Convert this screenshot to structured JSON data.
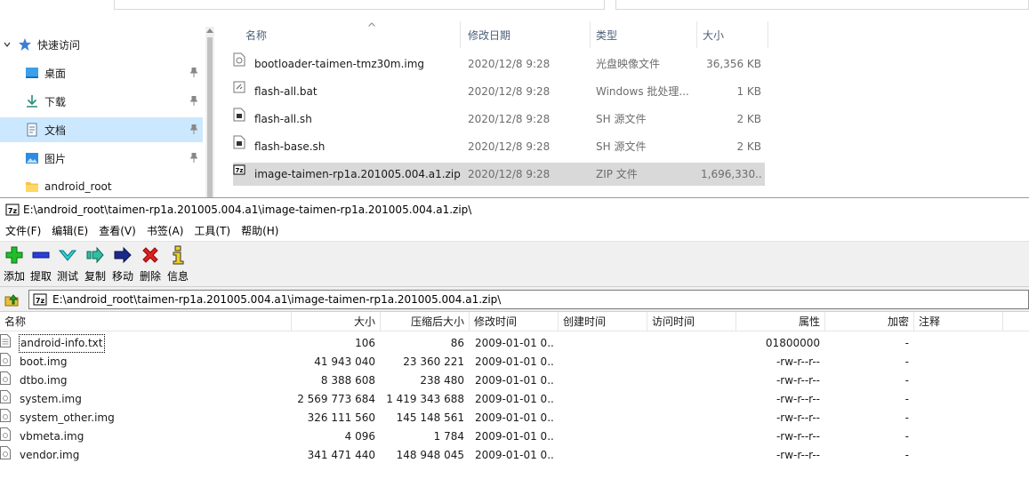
{
  "explorer": {
    "nav_items": [
      {
        "label": "快速访问",
        "icon": "star-icon",
        "pinned": false,
        "selected": false
      },
      {
        "label": "桌面",
        "icon": "desktop-icon",
        "pinned": true,
        "selected": false
      },
      {
        "label": "下载",
        "icon": "download-icon",
        "pinned": true,
        "selected": false
      },
      {
        "label": "文档",
        "icon": "documents-icon",
        "pinned": true,
        "selected": true
      },
      {
        "label": "图片",
        "icon": "pictures-icon",
        "pinned": true,
        "selected": false
      },
      {
        "label": "android_root",
        "icon": "folder-icon",
        "pinned": false,
        "selected": false
      }
    ],
    "columns": {
      "name": "名称",
      "date": "修改日期",
      "type": "类型",
      "size": "大小"
    },
    "files": [
      {
        "name": "bootloader-taimen-tmz30m.img",
        "date": "2020/12/8 9:28",
        "type": "光盘映像文件",
        "size": "36,356 KB",
        "icon": "disc-image-file-icon"
      },
      {
        "name": "flash-all.bat",
        "date": "2020/12/8 9:28",
        "type": "Windows 批处理...",
        "size": "1 KB",
        "icon": "batch-file-icon"
      },
      {
        "name": "flash-all.sh",
        "date": "2020/12/8 9:28",
        "type": "SH 源文件",
        "size": "2 KB",
        "icon": "script-file-icon"
      },
      {
        "name": "flash-base.sh",
        "date": "2020/12/8 9:28",
        "type": "SH 源文件",
        "size": "2 KB",
        "icon": "script-file-icon"
      },
      {
        "name": "image-taimen-rp1a.201005.004.a1.zip",
        "date": "2020/12/8 9:28",
        "type": "ZIP 文件",
        "size": "1,696,330...",
        "icon": "7zip-archive-icon",
        "selected": true
      }
    ]
  },
  "sevenzip": {
    "title": "E:\\android_root\\taimen-rp1a.201005.004.a1\\image-taimen-rp1a.201005.004.a1.zip\\",
    "menu": [
      "文件(F)",
      "编辑(E)",
      "查看(V)",
      "书签(A)",
      "工具(T)",
      "帮助(H)"
    ],
    "toolbar": {
      "add": "添加",
      "extract": "提取",
      "test": "测试",
      "copy": "复制",
      "move": "移动",
      "delete": "删除",
      "info": "信息"
    },
    "address": "E:\\android_root\\taimen-rp1a.201005.004.a1\\image-taimen-rp1a.201005.004.a1.zip\\",
    "columns": {
      "name": "名称",
      "size": "大小",
      "packed": "压缩后大小",
      "modified": "修改时间",
      "created": "创建时间",
      "accessed": "访问时间",
      "attributes": "属性",
      "encrypted": "加密",
      "comment": "注释"
    },
    "rows": [
      {
        "name": "android-info.txt",
        "size": "106",
        "packed": "86",
        "modified": "2009-01-01 0...",
        "attributes": "01800000",
        "encrypted": "-",
        "icon": "text-file-icon"
      },
      {
        "name": "boot.img",
        "size": "41 943 040",
        "packed": "23 360 221",
        "modified": "2009-01-01 0...",
        "attributes": "-rw-r--r--",
        "encrypted": "-",
        "icon": "image-file-icon"
      },
      {
        "name": "dtbo.img",
        "size": "8 388 608",
        "packed": "238 480",
        "modified": "2009-01-01 0...",
        "attributes": "-rw-r--r--",
        "encrypted": "-",
        "icon": "image-file-icon"
      },
      {
        "name": "system.img",
        "size": "2 569 773 684",
        "packed": "1 419 343 688",
        "modified": "2009-01-01 0...",
        "attributes": "-rw-r--r--",
        "encrypted": "-",
        "icon": "image-file-icon"
      },
      {
        "name": "system_other.img",
        "size": "326 111 560",
        "packed": "145 148 561",
        "modified": "2009-01-01 0...",
        "attributes": "-rw-r--r--",
        "encrypted": "-",
        "icon": "image-file-icon"
      },
      {
        "name": "vbmeta.img",
        "size": "4 096",
        "packed": "1 784",
        "modified": "2009-01-01 0...",
        "attributes": "-rw-r--r--",
        "encrypted": "-",
        "icon": "image-file-icon"
      },
      {
        "name": "vendor.img",
        "size": "341 471 440",
        "packed": "148 948 045",
        "modified": "2009-01-01 0...",
        "attributes": "-rw-r--r--",
        "encrypted": "-",
        "icon": "image-file-icon"
      }
    ]
  }
}
